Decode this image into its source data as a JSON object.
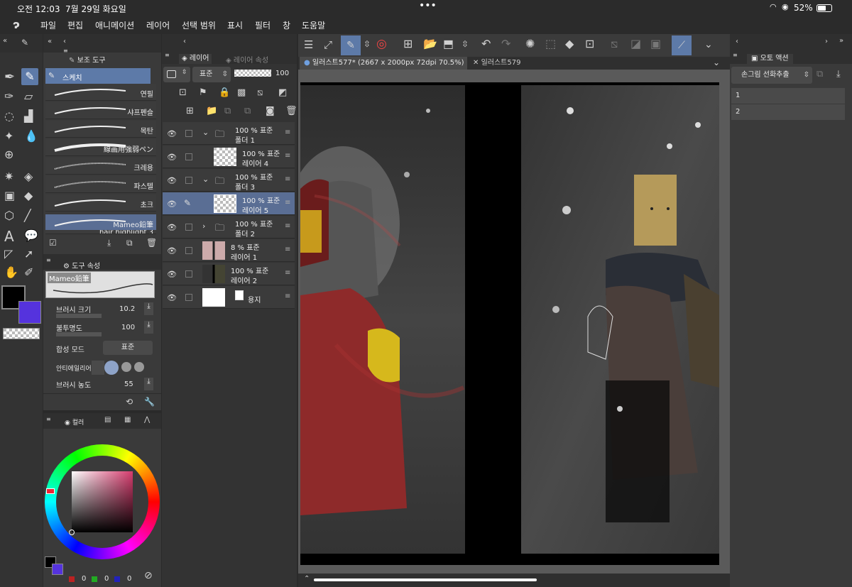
{
  "status": {
    "time": "오전 12:03",
    "date": "7월 29일 화요일",
    "battery": "52%"
  },
  "menu": [
    "파일",
    "편집",
    "애니메이션",
    "레이어",
    "선택 범위",
    "표시",
    "필터",
    "창",
    "도움말"
  ],
  "subtool": {
    "header": "보조 도구",
    "group": "스케치",
    "brushes": [
      "연필",
      "샤프펜슬",
      "목탄",
      "線画用強弱ペン",
      "크레용",
      "파스텔",
      "초크",
      "Mameo鉛筆",
      "hair highlight 3"
    ],
    "selected_index": 7
  },
  "tool_property": {
    "header": "도구 속성",
    "preview_label": "Mameo鉛筆",
    "brush_size_label": "브러시 크기",
    "brush_size_value": "10.2",
    "opacity_label": "불투명도",
    "opacity_value": "100",
    "blend_label": "합성 모드",
    "blend_value": "표준",
    "aa_label": "안티에일리어",
    "density_label": "브러시 농도",
    "density_value": "55"
  },
  "color": {
    "tab": "컬러",
    "r": "0",
    "g": "0",
    "b": "0"
  },
  "layers_panel": {
    "tab_layer": "레이어",
    "tab_prop": "레이어 속성",
    "blend": "표준",
    "opacity": "100",
    "layers": [
      {
        "pct": "100 % 표준",
        "name": "폴더 1",
        "type": "folder",
        "open": true
      },
      {
        "pct": "100 % 표준",
        "name": "레이어 4",
        "type": "layer"
      },
      {
        "pct": "100 % 표준",
        "name": "폴더 3",
        "type": "folder",
        "open": true
      },
      {
        "pct": "100 % 표준",
        "name": "레이어 5",
        "type": "layer",
        "selected": true
      },
      {
        "pct": "100 % 표준",
        "name": "폴더 2",
        "type": "folder",
        "open": false
      },
      {
        "pct": "8 % 표준",
        "name": "레이어 1",
        "type": "layer"
      },
      {
        "pct": "100 % 표준",
        "name": "레이어 2",
        "type": "layer"
      },
      {
        "pct": "",
        "name": "용지",
        "type": "paper"
      }
    ]
  },
  "canvas_tabs": [
    "일러스트577* (2667 x 2000px 72dpi 70.5%)",
    "일러스트579"
  ],
  "auto_action": {
    "header": "오토 액션",
    "set": "손그림 선화추출",
    "items": [
      "1",
      "2"
    ]
  },
  "colors": {
    "accent": "#5d7aa8",
    "selected_row": "#5a6e94",
    "main_color": "#000000",
    "sub_color": "#5533dd"
  }
}
